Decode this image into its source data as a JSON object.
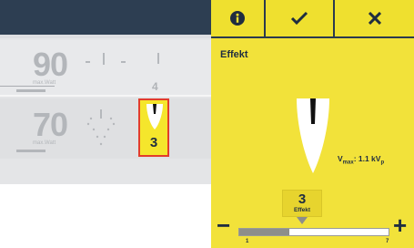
{
  "left": {
    "row1": {
      "value": "90",
      "max_label": "max.Watt",
      "digit": "4"
    },
    "row2": {
      "value": "70",
      "max_label": "max.Watt",
      "digit": "3"
    }
  },
  "panel": {
    "icons": [
      "info-icon",
      "checkmark-icon",
      "close-icon"
    ],
    "title": "Effekt",
    "vmax_prefix": "V",
    "vmax_sub": "max",
    "vmax_value": ": 1.1 kV",
    "vmax_suffix": "p",
    "setting": {
      "value": "3",
      "label": "Effekt",
      "min": "1",
      "max": "7",
      "level": 3
    },
    "minus_label": "−",
    "plus_label": "+"
  },
  "colors": {
    "panel": "#f2e23a",
    "highlight_border": "#e23c2b",
    "dark": "#2b3a4e"
  }
}
